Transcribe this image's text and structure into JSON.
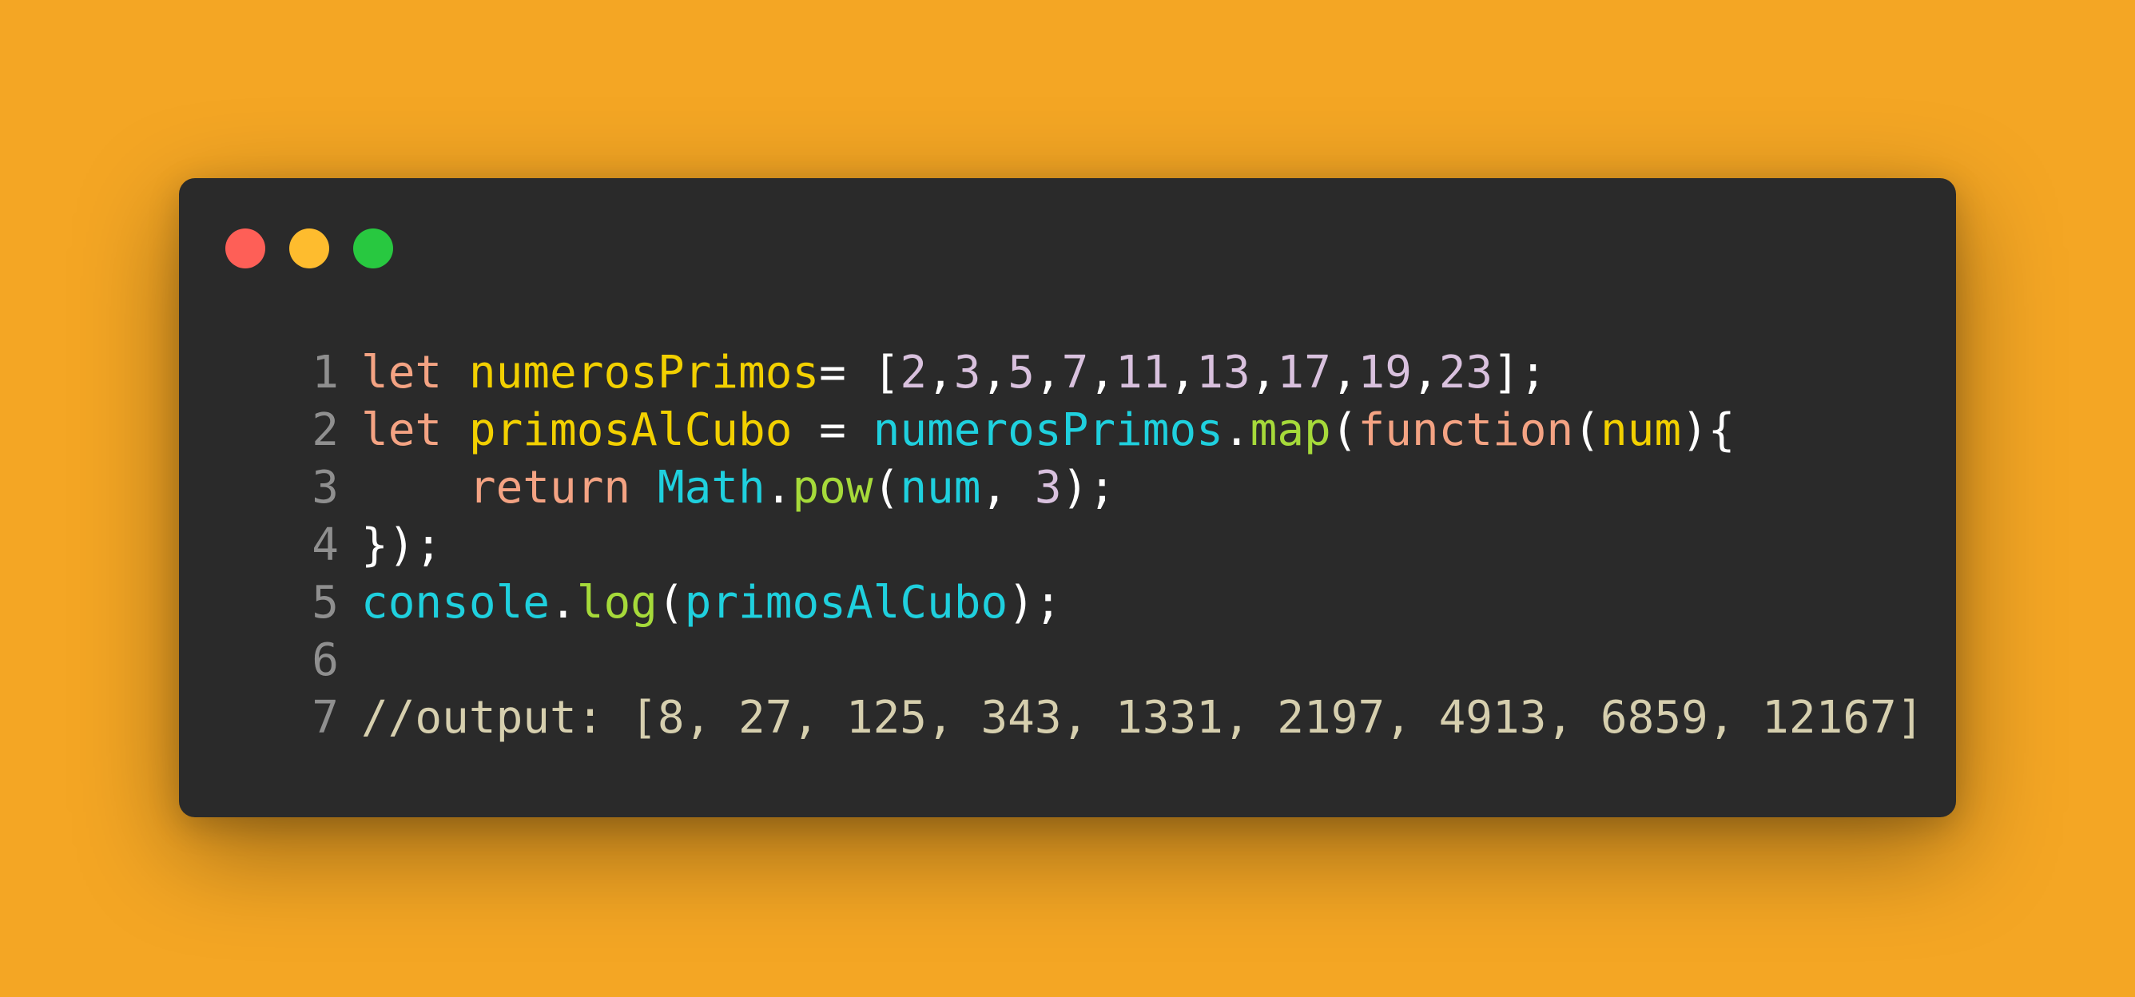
{
  "colors": {
    "background": "#f4a624",
    "window": "#2a2a2a",
    "line_number": "#8f8f8f",
    "keyword": "#f4a383",
    "variable": "#f2d000",
    "number": "#d9c1de",
    "punctuation": "#ffffff",
    "identifier": "#1fd0de",
    "method": "#a6da3a",
    "comment": "#d6cfae"
  },
  "window_controls": [
    {
      "name": "close",
      "color": "#fe5f57"
    },
    {
      "name": "minimize",
      "color": "#febc2e"
    },
    {
      "name": "zoom",
      "color": "#28c840"
    }
  ],
  "code_lines": [
    {
      "number": "1",
      "tokens": [
        {
          "text": "let",
          "kind": "keyword"
        },
        {
          "text": " ",
          "kind": "punctuation"
        },
        {
          "text": "numerosPrimos",
          "kind": "variable"
        },
        {
          "text": "= [",
          "kind": "punctuation"
        },
        {
          "text": "2",
          "kind": "number"
        },
        {
          "text": ",",
          "kind": "punctuation"
        },
        {
          "text": "3",
          "kind": "number"
        },
        {
          "text": ",",
          "kind": "punctuation"
        },
        {
          "text": "5",
          "kind": "number"
        },
        {
          "text": ",",
          "kind": "punctuation"
        },
        {
          "text": "7",
          "kind": "number"
        },
        {
          "text": ",",
          "kind": "punctuation"
        },
        {
          "text": "11",
          "kind": "number"
        },
        {
          "text": ",",
          "kind": "punctuation"
        },
        {
          "text": "13",
          "kind": "number"
        },
        {
          "text": ",",
          "kind": "punctuation"
        },
        {
          "text": "17",
          "kind": "number"
        },
        {
          "text": ",",
          "kind": "punctuation"
        },
        {
          "text": "19",
          "kind": "number"
        },
        {
          "text": ",",
          "kind": "punctuation"
        },
        {
          "text": "23",
          "kind": "number"
        },
        {
          "text": "];",
          "kind": "punctuation"
        }
      ]
    },
    {
      "number": "2",
      "tokens": [
        {
          "text": "let",
          "kind": "keyword"
        },
        {
          "text": " ",
          "kind": "punctuation"
        },
        {
          "text": "primosAlCubo",
          "kind": "variable"
        },
        {
          "text": " = ",
          "kind": "punctuation"
        },
        {
          "text": "numerosPrimos",
          "kind": "identifier"
        },
        {
          "text": ".",
          "kind": "punctuation"
        },
        {
          "text": "map",
          "kind": "method"
        },
        {
          "text": "(",
          "kind": "punctuation"
        },
        {
          "text": "function",
          "kind": "keyword"
        },
        {
          "text": "(",
          "kind": "punctuation"
        },
        {
          "text": "num",
          "kind": "variable"
        },
        {
          "text": "){",
          "kind": "punctuation"
        }
      ]
    },
    {
      "number": "3",
      "tokens": [
        {
          "text": "    ",
          "kind": "punctuation"
        },
        {
          "text": "return",
          "kind": "keyword"
        },
        {
          "text": " ",
          "kind": "punctuation"
        },
        {
          "text": "Math",
          "kind": "identifier"
        },
        {
          "text": ".",
          "kind": "punctuation"
        },
        {
          "text": "pow",
          "kind": "method"
        },
        {
          "text": "(",
          "kind": "punctuation"
        },
        {
          "text": "num",
          "kind": "identifier"
        },
        {
          "text": ", ",
          "kind": "punctuation"
        },
        {
          "text": "3",
          "kind": "number"
        },
        {
          "text": ");",
          "kind": "punctuation"
        }
      ]
    },
    {
      "number": "4",
      "tokens": [
        {
          "text": "});",
          "kind": "punctuation"
        }
      ]
    },
    {
      "number": "5",
      "tokens": [
        {
          "text": "console",
          "kind": "identifier"
        },
        {
          "text": ".",
          "kind": "punctuation"
        },
        {
          "text": "log",
          "kind": "method"
        },
        {
          "text": "(",
          "kind": "punctuation"
        },
        {
          "text": "primosAlCubo",
          "kind": "identifier"
        },
        {
          "text": ");",
          "kind": "punctuation"
        }
      ]
    },
    {
      "number": "6",
      "tokens": []
    },
    {
      "number": "7",
      "tokens": [
        {
          "text": "//output: [8, 27, 125, 343, 1331, 2197, 4913, 6859, 12167]",
          "kind": "comment"
        }
      ]
    }
  ]
}
